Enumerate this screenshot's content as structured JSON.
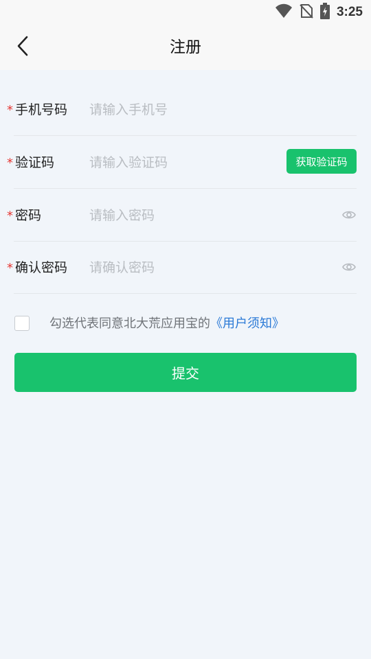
{
  "status_bar": {
    "time": "3:25",
    "icons": [
      "wifi-icon",
      "no-sim-icon",
      "battery-charging-icon"
    ]
  },
  "header": {
    "title": "注册",
    "back_icon": "chevron-left-icon"
  },
  "form": {
    "required_mark": "*",
    "phone": {
      "label": "手机号码",
      "placeholder": "请输入手机号",
      "value": ""
    },
    "code": {
      "label": "验证码",
      "placeholder": "请输入验证码",
      "value": "",
      "button_label": "获取验证码"
    },
    "password": {
      "label": "密码",
      "placeholder": "请输入密码",
      "value": "",
      "eye_icon": "eye-icon"
    },
    "confirm_password": {
      "label": "确认密码",
      "placeholder": "请确认密码",
      "value": "",
      "eye_icon": "eye-icon"
    }
  },
  "agreement": {
    "checked": false,
    "text": "勾选代表同意北大荒应用宝的",
    "link": "《用户须知》"
  },
  "submit_label": "提交",
  "colors": {
    "primary_green": "#19c26d",
    "link_blue": "#2a79d6",
    "required_red": "#e53935",
    "background": "#f1f5fa"
  }
}
